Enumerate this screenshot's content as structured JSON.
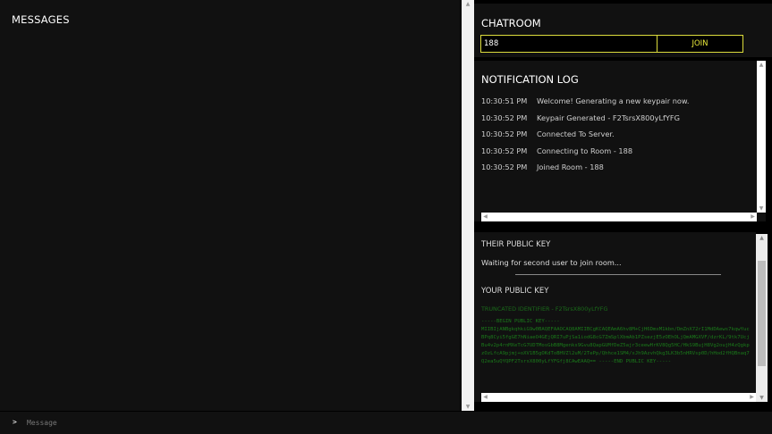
{
  "messages": {
    "title": "MESSAGES"
  },
  "chatroom": {
    "title": "CHATROOM",
    "room_value": "188",
    "join_label": "JOIN"
  },
  "notification_log": {
    "title": "NOTIFICATION LOG",
    "entries": [
      {
        "time": "10:30:51 PM",
        "text": "Welcome! Generating a new keypair now."
      },
      {
        "time": "10:30:52 PM",
        "text": "Keypair Generated - F2TsrsX800yLfYFG"
      },
      {
        "time": "10:30:52 PM",
        "text": "Connected To Server."
      },
      {
        "time": "10:30:52 PM",
        "text": "Connecting to Room - 188"
      },
      {
        "time": "10:30:52 PM",
        "text": "Joined Room - 188"
      }
    ]
  },
  "keys": {
    "their_title": "THEIR PUBLIC KEY",
    "waiting_text": "Waiting for second user to join room...",
    "your_title": "YOUR PUBLIC KEY",
    "truncated_id": "TRUNCATED IDENTIFIER - F2TsrsX800yLfYFG",
    "public_key": "-----BEGIN PUBLIC KEY-----\nMIIBIjANBgkqhkiG9w0BAQEFAAOCAQ8AMIIBCgKCAQEAmA6hv8M+CjH6DmxM1kbn/DmZnX72rI1MdDAews7kqwYucBPq8Cyi5fgGE7hNiaeO4GEjQRI7uPjSa1iodG8cG7ZmSplXbmAb1PZsezjE5zOEhOLjQmAMGXVF/dzrKL/9tk7UcjBu4v2p4rnMXeTcG7UDTMosGbB8Mgenks9Gvu8QapGUMfDeZ5ajr3ceewHrKV8Qg5HC/HkS9BujH8Vg2oujH4zQgkpzOzLfcA9pjmj+oXV1B5gOKdToBHVZl2uM/2TePp/Qhhce1SM4/xJh9AzvhQkg3LK3b5nHRVsp0D/hHod2fHQBnaq7Q2ea5uQYQPF2TsrsX800yLfYFGfj8CAwEAAQ== -----END PUBLIC KEY-----"
  },
  "input": {
    "prompt": ">",
    "placeholder": "Message"
  }
}
